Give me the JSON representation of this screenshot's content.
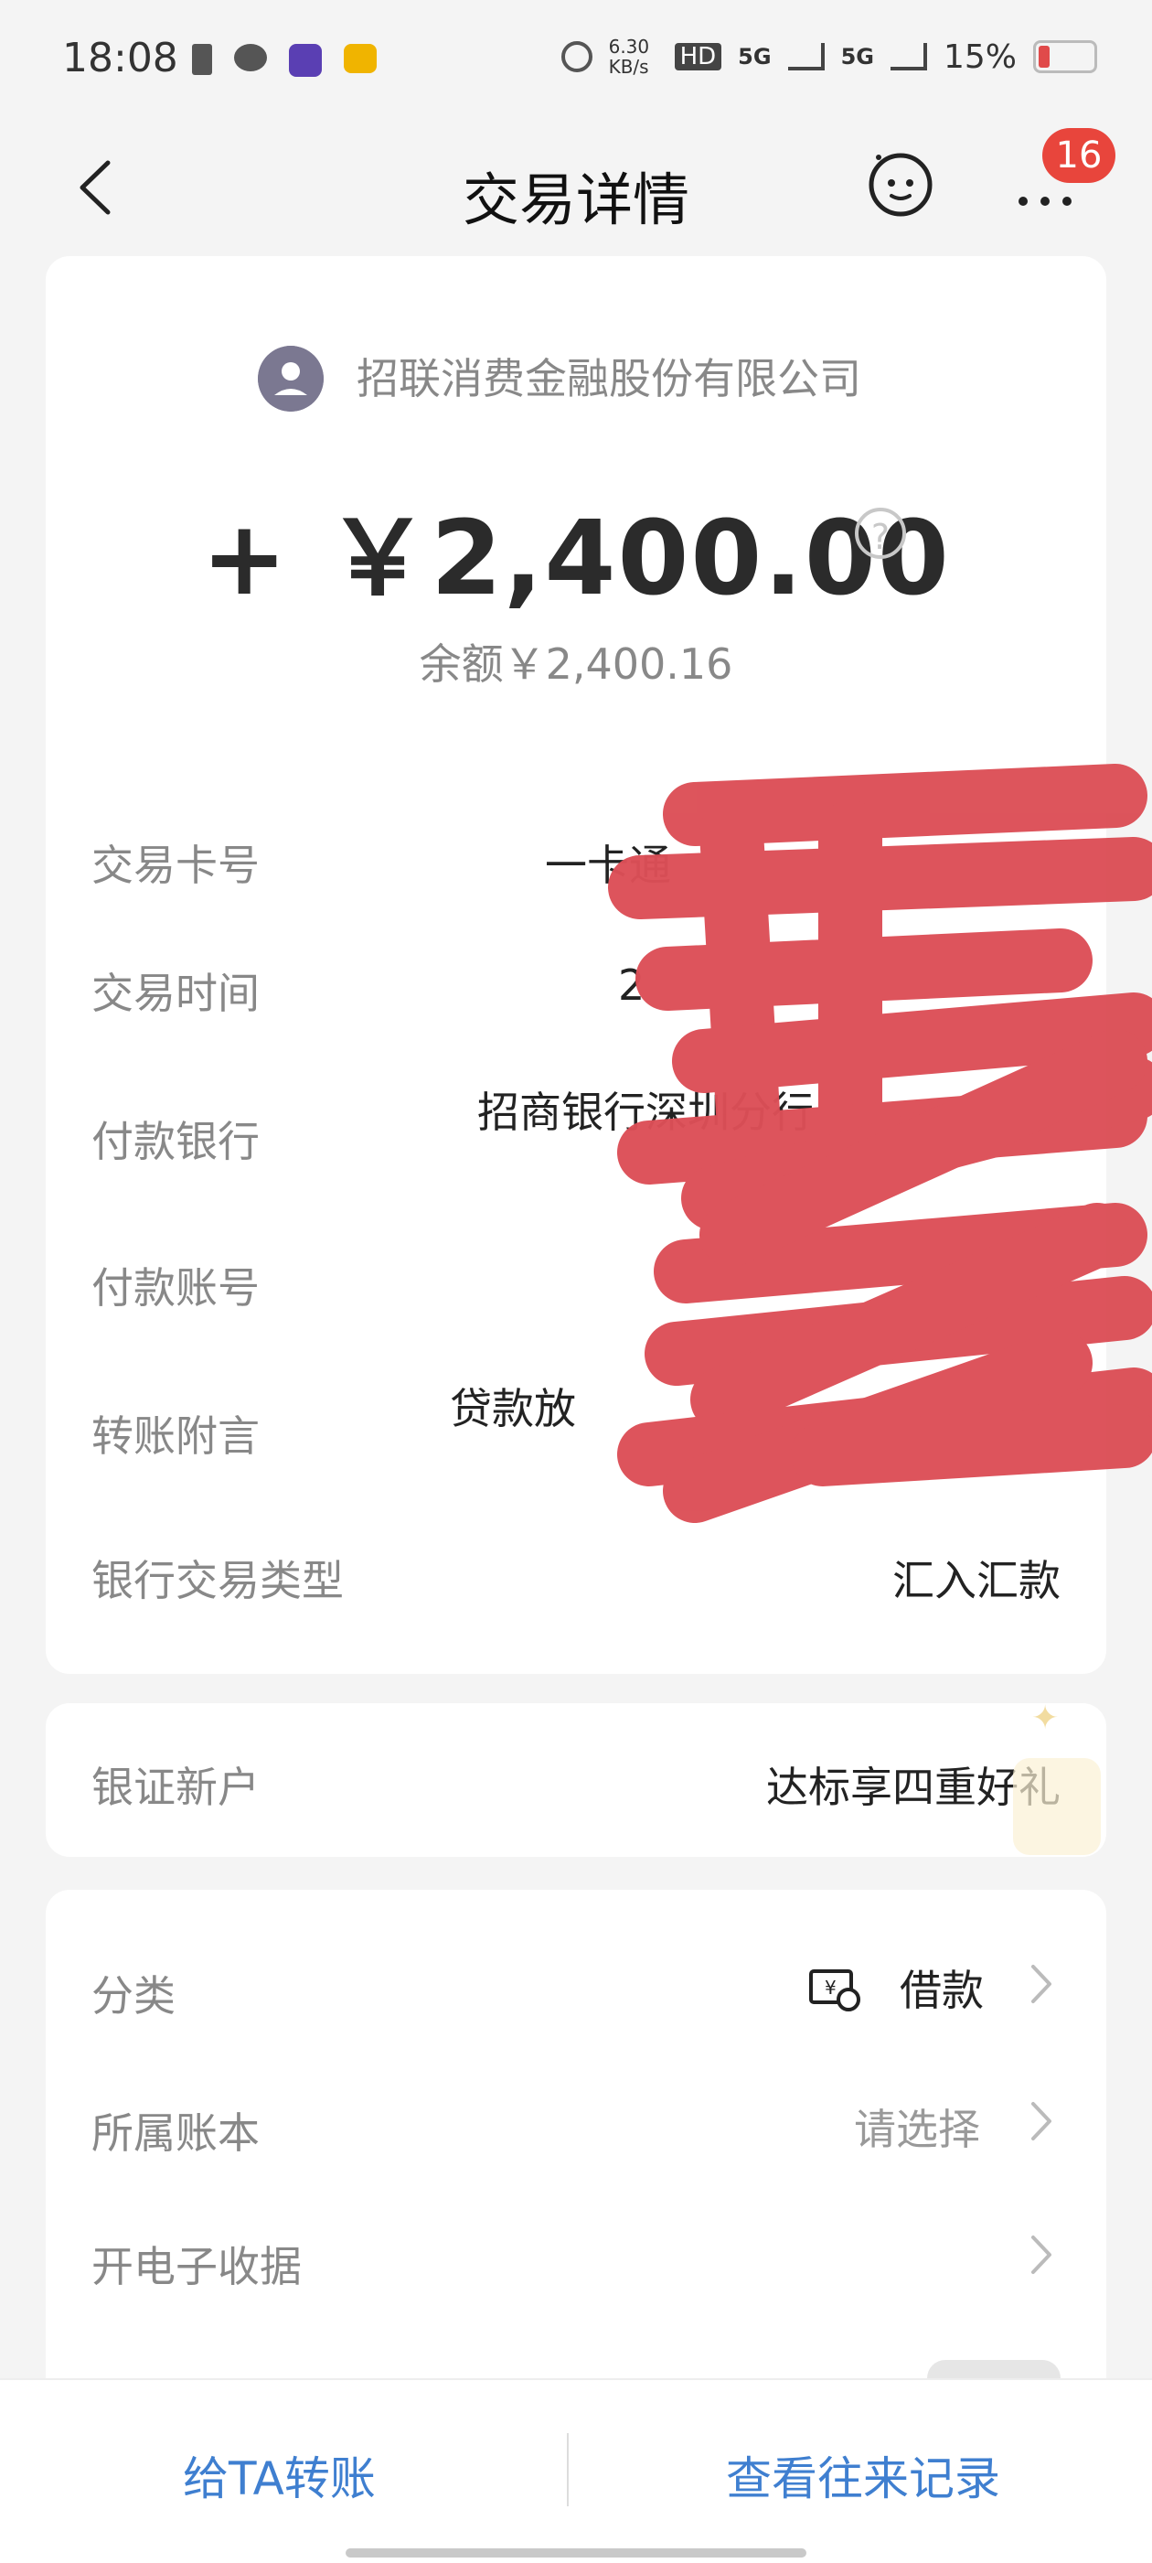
{
  "status_bar": {
    "time": "18:08",
    "network_speed": "6.30 KB/s",
    "signal1": "5G",
    "signal2": "5G",
    "battery": "15%"
  },
  "header": {
    "title": "交易详情",
    "badge_count": "16"
  },
  "transaction": {
    "payer": "招联消费金融股份有限公司",
    "amount": "+ ￥2,400.00",
    "balance": "余额￥2,400.16",
    "help": "?",
    "rows": [
      {
        "label": "交易卡号",
        "value": "一卡通"
      },
      {
        "label": "交易时间",
        "value": "2"
      },
      {
        "label": "付款银行",
        "value": "招商银行深圳分行"
      },
      {
        "label": "付款账号",
        "value": ""
      },
      {
        "label": "转账附言",
        "value": "贷款放"
      },
      {
        "label": "银行交易类型",
        "value": "汇入汇款"
      }
    ]
  },
  "promo": {
    "label": "银证新户",
    "value": "达标享四重好礼"
  },
  "settings": {
    "category_label": "分类",
    "category_value": "借款",
    "ledger_label": "所属账本",
    "ledger_value": "请选择",
    "receipt_label": "开电子收据"
  },
  "bottom": {
    "transfer": "给TA转账",
    "history": "查看往来记录"
  },
  "colors": {
    "accent": "#3f7fd0",
    "badge": "#e8453c",
    "scribble": "#dc4f57"
  }
}
